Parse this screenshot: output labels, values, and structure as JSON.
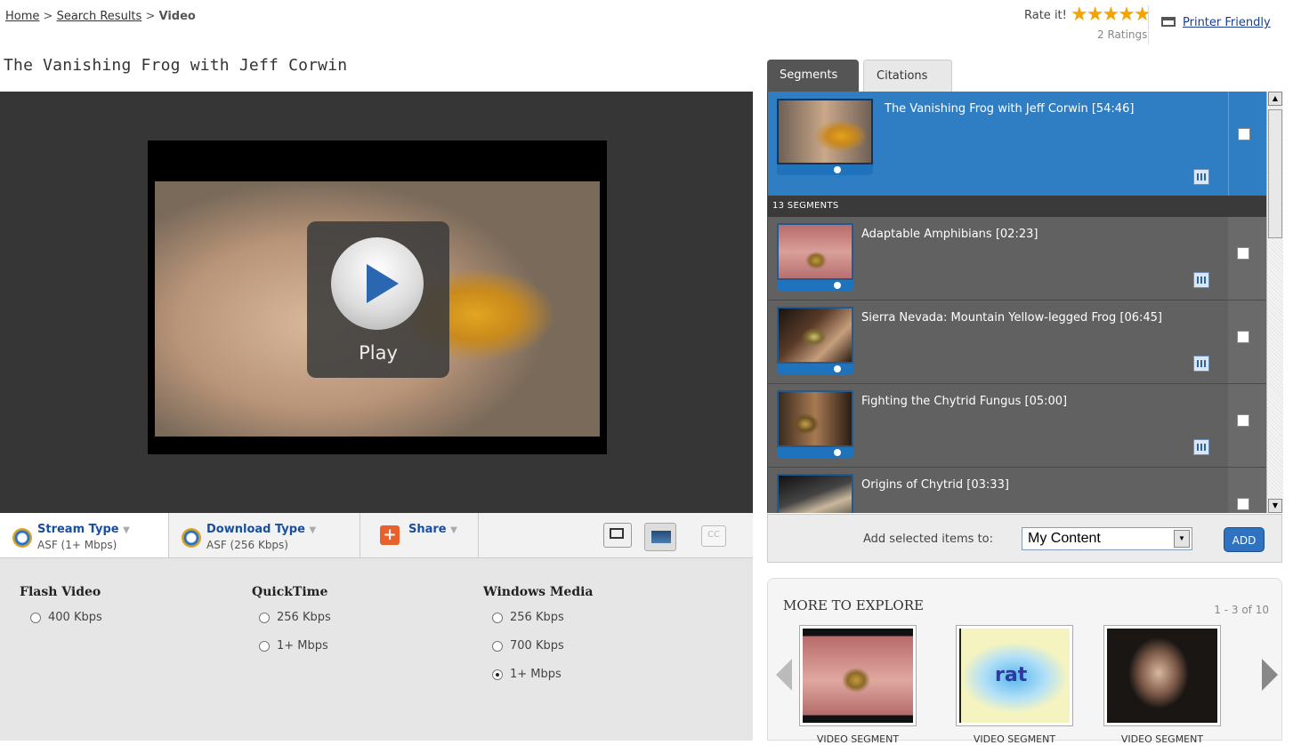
{
  "breadcrumb": {
    "home": "Home",
    "sep1": " > ",
    "search": "Search Results",
    "sep2": " > ",
    "current": "Video"
  },
  "page_title": "The Vanishing Frog with Jeff Corwin",
  "rating": {
    "label": "Rate it!",
    "stars": "★★★★★",
    "count": "2 Ratings",
    "star_color": "#f5a300"
  },
  "printer": {
    "label": "Printer Friendly"
  },
  "player": {
    "play_label": "Play"
  },
  "format_tabs": [
    {
      "title": "Stream Type",
      "sub": "ASF (1+ Mbps)"
    },
    {
      "title": "Download Type",
      "sub": "ASF (256 Kbps)"
    },
    {
      "title": "Share"
    }
  ],
  "cc_label": "CC",
  "formats": {
    "flash": {
      "title": "Flash Video",
      "options": [
        {
          "label": "400 Kbps",
          "selected": false
        }
      ]
    },
    "quicktime": {
      "title": "QuickTime",
      "options": [
        {
          "label": "256 Kbps",
          "selected": false
        },
        {
          "label": "1+ Mbps",
          "selected": false
        }
      ]
    },
    "windows_media": {
      "title": "Windows Media",
      "options": [
        {
          "label": "256 Kbps",
          "selected": false
        },
        {
          "label": "700 Kbps",
          "selected": false
        },
        {
          "label": "1+ Mbps",
          "selected": true
        }
      ]
    }
  },
  "tabs": {
    "segments": "Segments",
    "citations": "Citations"
  },
  "main_segment": {
    "title": "The Vanishing Frog with Jeff Corwin [54:46]",
    "checked": false
  },
  "segment_count": "13 SEGMENTS",
  "segments": [
    {
      "title": "Adaptable Amphibians [02:23]",
      "checked": false
    },
    {
      "title": "Sierra Nevada: Mountain Yellow-legged Frog [06:45]",
      "checked": false
    },
    {
      "title": "Fighting the Chytrid Fungus [05:00]",
      "checked": false
    },
    {
      "title": "Origins of Chytrid [03:33]",
      "checked": false
    }
  ],
  "add_to": {
    "label": "Add selected items to:",
    "selected": "My Content",
    "button": "ADD"
  },
  "explore": {
    "title": "MORE TO EXPLORE",
    "count": "1 - 3 of 10",
    "cards": [
      {
        "label": "VIDEO SEGMENT",
        "text": ""
      },
      {
        "label": "VIDEO SEGMENT",
        "text": "rat"
      },
      {
        "label": "VIDEO SEGMENT",
        "text": ""
      }
    ]
  },
  "colors": {
    "accent_blue": "#2f7ec4",
    "brand_link": "#1a3e8c",
    "share_orange": "#e8602c"
  }
}
